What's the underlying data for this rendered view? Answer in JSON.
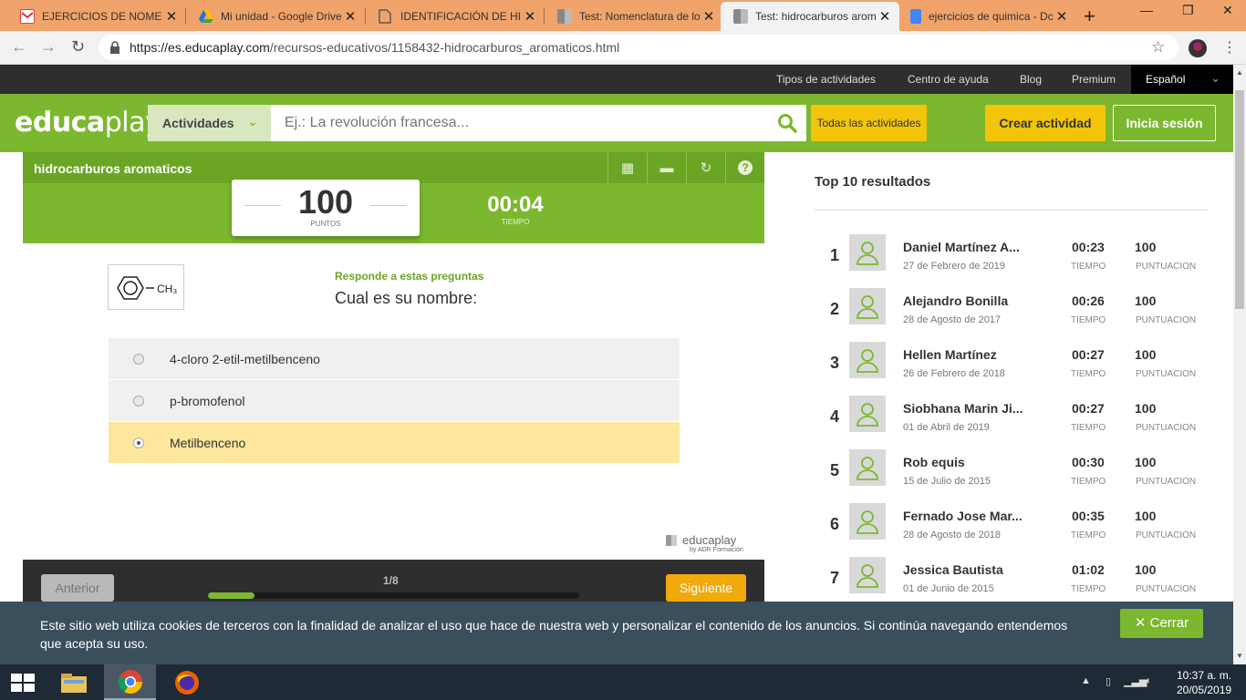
{
  "browser": {
    "tabs": [
      {
        "title": "EJERCICIOS DE NOMENCLAT",
        "favicon": "gmail-icon"
      },
      {
        "title": "Mi unidad - Google Drive",
        "favicon": "drive-icon"
      },
      {
        "title": "IDENTIFICACIÓN DE HIDRO",
        "favicon": "document-icon"
      },
      {
        "title": "Test: Nomenclatura de los",
        "favicon": "educaplay-icon"
      },
      {
        "title": "Test: hidrocarburos aromat",
        "favicon": "educaplay-icon"
      },
      {
        "title": "ejercicios de quimica - Doc",
        "favicon": "docs-icon"
      }
    ],
    "url_host": "https://es.educaplay.com",
    "url_path": "/recursos-educativos/1158432-hidrocarburos_aromaticos.html"
  },
  "topnav": {
    "links": [
      "Tipos de actividades",
      "Centro de ayuda",
      "Blog",
      "Premium"
    ],
    "language": "Español"
  },
  "header": {
    "logo_bold": "educa",
    "logo_light": "play",
    "category": "Actividades",
    "search_placeholder": "Ej.: La revolución francesa...",
    "all_activities": "Todas las actividades",
    "create": "Crear actividad",
    "login": "Inicia sesión"
  },
  "game": {
    "title": "hidrocarburos aromaticos",
    "score": "100",
    "score_label": "PUNTOS",
    "time": "00:04",
    "time_label": "TIEMPO",
    "instruction": "Responde a estas preguntas",
    "question": "Cual es su nombre:",
    "molecule_label": "CH₃",
    "answers": [
      {
        "text": "4-cloro 2-etil-metilbenceno",
        "selected": false
      },
      {
        "text": "p-bromofenol",
        "selected": false
      },
      {
        "text": "Metilbenceno",
        "selected": true
      }
    ],
    "brand": "educaplay",
    "brand_by": "by ADR Formación",
    "prev": "Anterior",
    "next": "Siguiente",
    "progress_label": "1/8",
    "progress_fraction": 0.125
  },
  "ranking": {
    "title": "Top 10 resultados",
    "time_label": "TIEMPO",
    "points_label": "PUNTUACION",
    "rows": [
      {
        "rank": "1",
        "name": "Daniel Martínez A...",
        "date": "27 de Febrero de 2019",
        "time": "00:23",
        "points": "100"
      },
      {
        "rank": "2",
        "name": "Alejandro Bonilla",
        "date": "28 de Agosto de 2017",
        "time": "00:26",
        "points": "100"
      },
      {
        "rank": "3",
        "name": "Hellen Martínez",
        "date": "26 de Febrero de 2018",
        "time": "00:27",
        "points": "100"
      },
      {
        "rank": "4",
        "name": "Siobhana Marin Ji...",
        "date": "01 de Abril de 2019",
        "time": "00:27",
        "points": "100"
      },
      {
        "rank": "5",
        "name": "Rob equis",
        "date": "15 de Julio de 2015",
        "time": "00:30",
        "points": "100"
      },
      {
        "rank": "6",
        "name": "Fernado Jose Mar...",
        "date": "28 de Agosto de 2018",
        "time": "00:35",
        "points": "100"
      },
      {
        "rank": "7",
        "name": "Jessica Bautista",
        "date": "01 de Junio de 2015",
        "time": "01:02",
        "points": "100"
      }
    ]
  },
  "cookie": {
    "text": "Este sitio web utiliza cookies de terceros con la finalidad de analizar el uso que hace de nuestra web y personalizar el contenido de los anuncios. Si continúa navegando entendemos que acepta su uso.",
    "close": "Cerrar"
  },
  "taskbar": {
    "time": "10:37 a. m.",
    "date": "20/05/2019"
  },
  "colors": {
    "brand_green": "#7cb82f",
    "accent_yellow": "#f2c40a",
    "selected_answer": "#fde79c",
    "next_orange": "#f2a90a"
  }
}
